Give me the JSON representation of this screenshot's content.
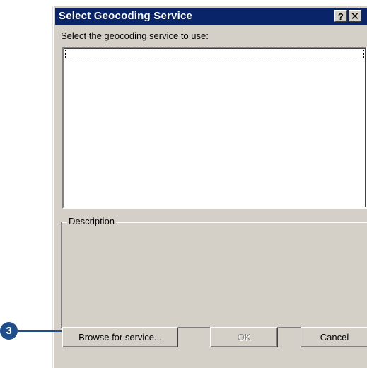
{
  "dialog": {
    "title": "Select Geocoding Service",
    "help_label": "?",
    "close_label": "✕",
    "prompt": "Select the geocoding service to use:",
    "service_list": [],
    "description": {
      "legend": "Description",
      "text": ""
    },
    "buttons": {
      "browse": "Browse for service...",
      "ok": "OK",
      "cancel": "Cancel"
    },
    "ok_enabled": false
  },
  "callout": {
    "number": "3"
  },
  "colors": {
    "titlebar": "#0a246a",
    "dialog_face": "#d4d0c8",
    "callout": "#1f4e8c"
  }
}
